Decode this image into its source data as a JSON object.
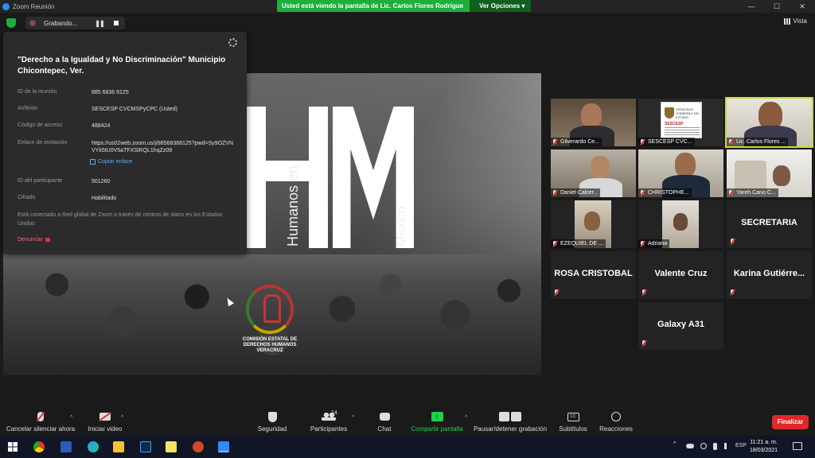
{
  "window": {
    "title": "Zoom Reunión",
    "controls": [
      "—",
      "☐",
      "✕"
    ]
  },
  "share_banner": {
    "message": "Usted está viendo la pantalla de Lic. Carlos Flores Rodrigue",
    "options_label": "Ver Opciones",
    "options_caret": "▾"
  },
  "recording": {
    "label": "Grabando...",
    "pause_glyph": "❚❚"
  },
  "view_button": {
    "label": "Vista"
  },
  "meeting_info": {
    "title": "\"Derecho a la Igualdad y No Discriminación\" Municipio Chicontepec, Ver.",
    "rows": [
      {
        "label": "ID de la reunión",
        "value": "885 6836 8125"
      },
      {
        "label": "Anfitrión",
        "value": "SESCESP CVCMSPyCPC (Usted)"
      },
      {
        "label": "Código de acceso",
        "value": "488424"
      },
      {
        "label": "Enlace de invitación",
        "value": "https://us02web.zoom.us/j/88568368125?pwd=Sy9OZVNVYk5tU0V5aTFXSlRQL1hqZz09"
      },
      {
        "label": "ID del participante",
        "value": "501260"
      },
      {
        "label": "Cifrado",
        "value": "Habilitado"
      }
    ],
    "copy_link": "Copiar enlace",
    "connection_note": "Está conectado a Red global de Zoom a través de centros de datos en los Estados Unidos",
    "report": "Denunciar"
  },
  "shared_screen": {
    "vertical_text_1": "Humanos en",
    "vertical_text_2": "México",
    "logo_text": "COMISIÓN ESTATAL DE DERECHOS HUMANOS VERACRUZ"
  },
  "participants": [
    {
      "name": "Gilverardo Ce...",
      "type": "video",
      "muted": true
    },
    {
      "name": "SESCESP CVC...",
      "type": "logo",
      "muted": true,
      "logo_title": "VERACRUZ GOBIERNO DEL ESTADO",
      "logo_sub": "SESCESP"
    },
    {
      "name": "Lic. Carlos Flores ...",
      "type": "video",
      "muted": true,
      "active": true
    },
    {
      "name": "Daniel Calcer...",
      "type": "video",
      "muted": true
    },
    {
      "name": "CHRISTOPHE...",
      "type": "video",
      "muted": true
    },
    {
      "name": "Yareh Cano C...",
      "type": "video",
      "muted": true
    },
    {
      "name": "EZEQUIEL DE ...",
      "type": "video",
      "muted": true
    },
    {
      "name": "Adriana",
      "type": "video",
      "muted": true
    },
    {
      "name": "SECRETARIA",
      "type": "name",
      "muted": true
    },
    {
      "name": "ROSA CRISTOBAL",
      "type": "name",
      "muted": true
    },
    {
      "name": "Valente Cruz",
      "type": "name",
      "muted": true
    },
    {
      "name": "Karina  Gutiérre...",
      "type": "name",
      "muted": true
    },
    {
      "name": "Galaxy A31",
      "type": "name",
      "muted": true
    }
  ],
  "toolbar": {
    "mute": "Cancelar silenciar ahora",
    "video": "Iniciar video",
    "security": "Seguridad",
    "participants": "Participantes",
    "participants_count": "14",
    "chat": "Chat",
    "share": "Compartir pantalla",
    "record": "Pausar/detener grabación",
    "subtitles": "Subtítulos",
    "subtitles_icon": "CC",
    "reactions": "Reacciones",
    "end": "Finalizar",
    "caret": "^"
  },
  "taskbar": {
    "apps": [
      "chrome",
      "word",
      "edge",
      "file-explorer",
      "photoshop",
      "sticky-notes",
      "powerpoint",
      "zoom"
    ],
    "tray_arrow": "^",
    "language": "ESP",
    "time": "11:21 a. m.",
    "date": "18/03/2021"
  },
  "colors": {
    "accent_green": "#1fae3c",
    "end_red": "#e02828",
    "active_speaker": "#c4e02b",
    "link_blue": "#5da9ff"
  }
}
